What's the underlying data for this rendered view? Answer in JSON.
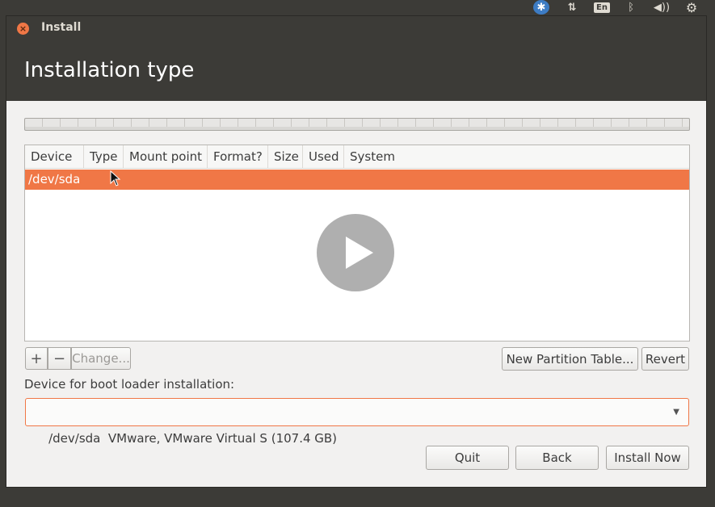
{
  "indicators": {
    "accessibility_icon": "accessibility-icon",
    "network_icon": "network-transfer-icon",
    "keyboard_layout": "En",
    "bluetooth_icon": "bluetooth-icon",
    "volume_icon": "volume-icon",
    "settings_icon": "gear-icon"
  },
  "window": {
    "title": "Install",
    "close_icon": "close-icon"
  },
  "page": {
    "title": "Installation type"
  },
  "partition_table": {
    "columns": [
      "Device",
      "Type",
      "Mount point",
      "Format?",
      "Size",
      "Used",
      "System"
    ],
    "rows": [
      {
        "device": "/dev/sda",
        "selected": true
      }
    ]
  },
  "partition_buttons": {
    "add": "+",
    "remove": "−",
    "change": "Change...",
    "new_partition_table": "New Partition Table...",
    "revert": "Revert"
  },
  "bootloader": {
    "label": "Device for boot loader installation:",
    "selected": "/dev/sda  VMware, VMware Virtual S (107.4 GB)"
  },
  "actions": {
    "quit": "Quit",
    "back": "Back",
    "install_now": "Install Now"
  },
  "colors": {
    "accent": "#f07746",
    "panel": "#3c3b37",
    "window_bg": "#f2f1f0"
  }
}
